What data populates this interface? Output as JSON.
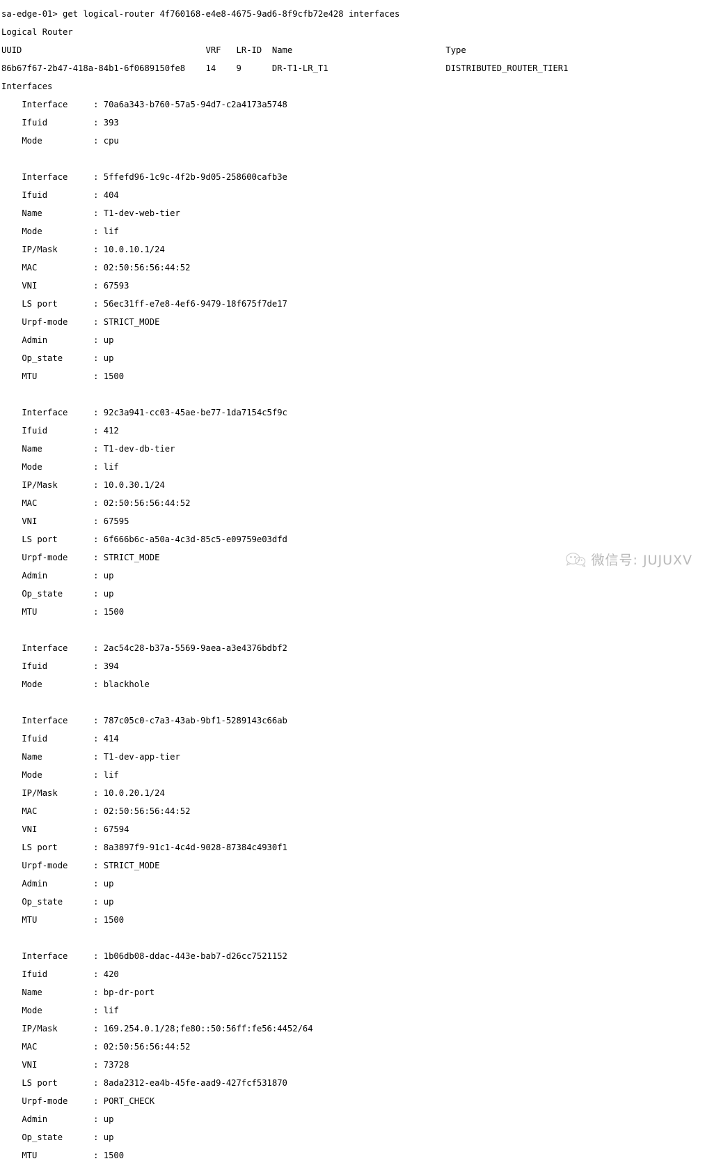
{
  "terminal": {
    "prompt": "sa-edge-01>",
    "command": "get logical-router 4f760168-e4e8-4675-9ad6-8f9cfb72e428 interfaces",
    "prompt_line": "sa-edge-01> get logical-router 4f760168-e4e8-4675-9ad6-8f9cfb72e428 interfaces",
    "section_router": "Logical Router",
    "section_interfaces": "Interfaces",
    "router_table": {
      "headers": [
        "UUID",
        "VRF",
        "LR-ID",
        "Name",
        "Type"
      ],
      "header_line": "UUID                                    VRF   LR-ID  Name                         Type",
      "value_line": "86b67f67-2b47-418a-84b1-6f0689150fe8    14    9      DR-T1-LR_T1                  DISTRIBUTED_ROUTER_TIER1",
      "row": {
        "uuid": "86b67f67-2b47-418a-84b1-6f0689150fe8",
        "vrf": "14",
        "lr_id": "9",
        "name": "DR-T1-LR_T1",
        "type": "DISTRIBUTED_ROUTER_TIER1"
      }
    },
    "field_labels": {
      "interface": "Interface",
      "ifuid": "Ifuid",
      "name": "Name",
      "mode": "Mode",
      "ip_mask": "IP/Mask",
      "mac": "MAC",
      "vni": "VNI",
      "ls_port": "LS port",
      "urpf_mode": "Urpf-mode",
      "admin": "Admin",
      "op_state": "Op_state",
      "mtu": "MTU"
    },
    "interfaces": [
      {
        "Interface": "70a6a343-b760-57a5-94d7-c2a4173a5748",
        "Ifuid": "393",
        "Mode": "cpu"
      },
      {
        "Interface": "5ffefd96-1c9c-4f2b-9d05-258600cafb3e",
        "Ifuid": "404",
        "Name": "T1-dev-web-tier",
        "Mode": "lif",
        "IP/Mask": "10.0.10.1/24",
        "MAC": "02:50:56:56:44:52",
        "VNI": "67593",
        "LS port": "56ec31ff-e7e8-4ef6-9479-18f675f7de17",
        "Urpf-mode": "STRICT_MODE",
        "Admin": "up",
        "Op_state": "up",
        "MTU": "1500"
      },
      {
        "Interface": "92c3a941-cc03-45ae-be77-1da7154c5f9c",
        "Ifuid": "412",
        "Name": "T1-dev-db-tier",
        "Mode": "lif",
        "IP/Mask": "10.0.30.1/24",
        "MAC": "02:50:56:56:44:52",
        "VNI": "67595",
        "LS port": "6f666b6c-a50a-4c3d-85c5-e09759e03dfd",
        "Urpf-mode": "STRICT_MODE",
        "Admin": "up",
        "Op_state": "up",
        "MTU": "1500"
      },
      {
        "Interface": "2ac54c28-b37a-5569-9aea-a3e4376bdbf2",
        "Ifuid": "394",
        "Mode": "blackhole"
      },
      {
        "Interface": "787c05c0-c7a3-43ab-9bf1-5289143c66ab",
        "Ifuid": "414",
        "Name": "T1-dev-app-tier",
        "Mode": "lif",
        "IP/Mask": "10.0.20.1/24",
        "MAC": "02:50:56:56:44:52",
        "VNI": "67594",
        "LS port": "8a3897f9-91c1-4c4d-9028-87384c4930f1",
        "Urpf-mode": "STRICT_MODE",
        "Admin": "up",
        "Op_state": "up",
        "MTU": "1500"
      },
      {
        "Interface": "1b06db08-ddac-443e-bab7-d26cc7521152",
        "Ifuid": "420",
        "Name": "bp-dr-port",
        "Mode": "lif",
        "IP/Mask": "169.254.0.1/28;fe80::50:56ff:fe56:4452/64",
        "MAC": "02:50:56:56:44:52",
        "VNI": "73728",
        "LS port": "8ada2312-ea4b-45fe-aad9-427fcf531870",
        "Urpf-mode": "PORT_CHECK",
        "Admin": "up",
        "Op_state": "up",
        "MTU": "1500"
      }
    ]
  },
  "watermark": {
    "icon": "wechat-icon",
    "text": "微信号: JUJUXV",
    "color": "#bcbcbc"
  },
  "colors": {
    "background": "#ffffff",
    "text": "#000000",
    "watermark": "#bcbcbc"
  }
}
